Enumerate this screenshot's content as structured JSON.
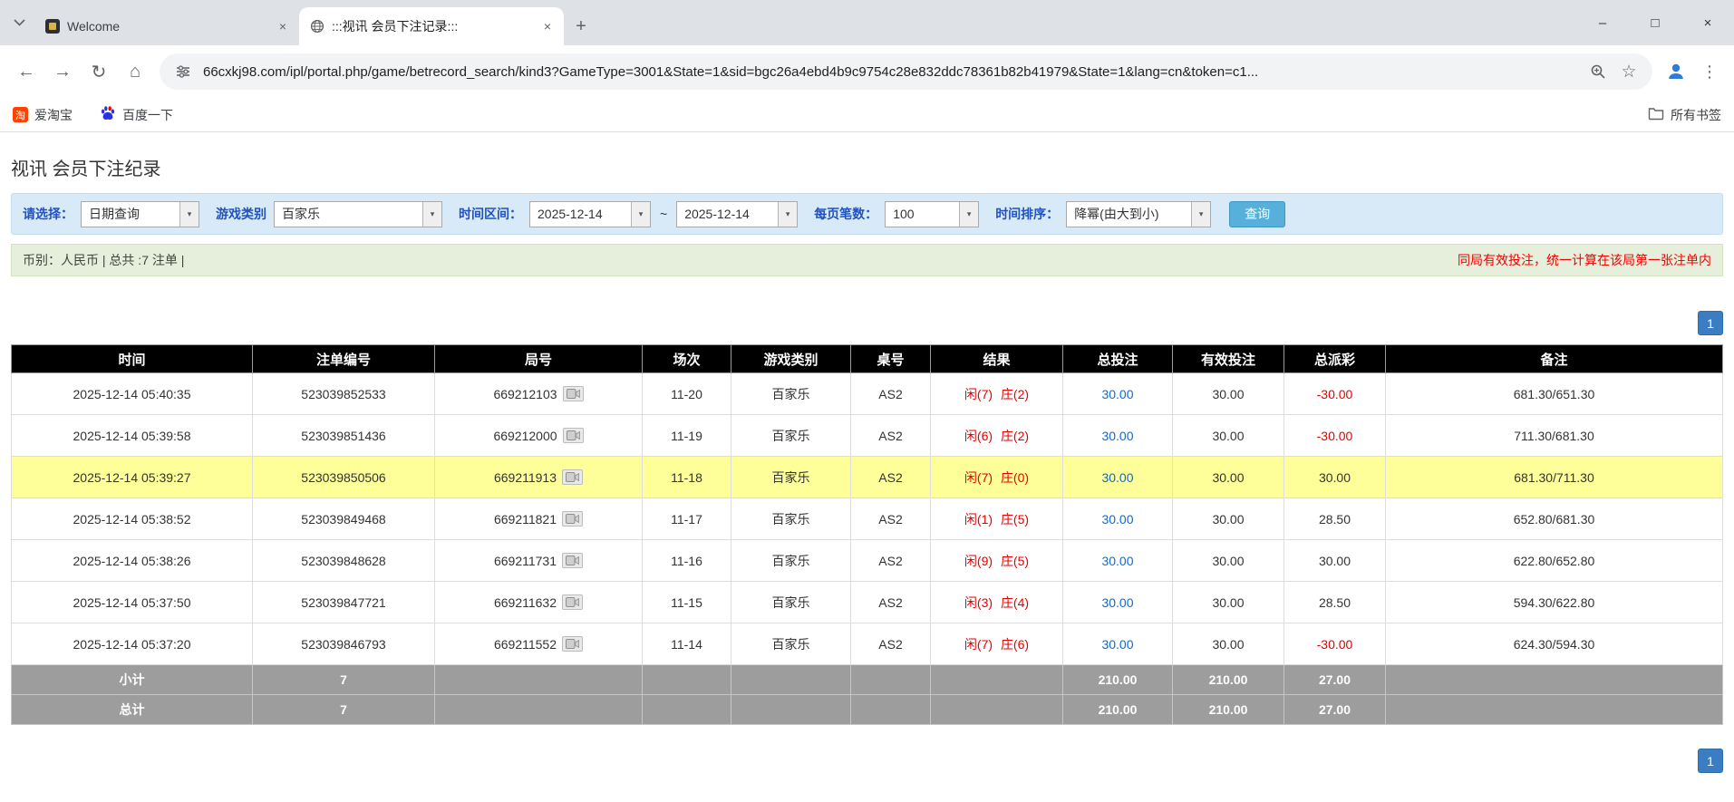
{
  "colors": {
    "accent_blue": "#2052c0",
    "link_blue": "#0a6cd6",
    "negative_red": "#e60000",
    "result_red": "#e60000",
    "highlight_yellow": "#ffff99",
    "table_header_bg": "#000000",
    "summary_bg": "#9d9d9d",
    "search_button_bg": "#57b0da",
    "pager_bg": "#3b7dc2",
    "filter_bar_bg": "#d8eaf7",
    "info_bar_bg": "#e5efdb"
  },
  "icons": {
    "back": "←",
    "forward": "→",
    "reload": "↻",
    "home": "⌂",
    "star": "☆",
    "menu": "⋮",
    "minimize": "–",
    "maximize": "□",
    "close": "×",
    "new_tab": "+",
    "tab_close": "×",
    "combo_arrow": "▾"
  },
  "browser": {
    "tabs": [
      {
        "title": "Welcome"
      },
      {
        "title": ":::视讯 会员下注记录:::"
      }
    ],
    "url": "66cxkj98.com/ipl/portal.php/game/betrecord_search/kind3?GameType=3001&State=1&sid=bgc26a4ebd4b9c9754c28e832ddc78361b82b41979&State=1&lang=cn&token=c1...",
    "bookmarks": [
      {
        "label": "爱淘宝"
      },
      {
        "label": "百度一下"
      }
    ],
    "all_bookmarks": "所有书签"
  },
  "page": {
    "title": "视讯 会员下注纪录",
    "filters": {
      "select_label": "请选择：",
      "select_value": "日期查询",
      "game_label": "游戏类别",
      "game_value": "百家乐",
      "range_label": "时间区间：",
      "date_from": "2025-12-14",
      "date_to": "2025-12-14",
      "range_sep": "~",
      "page_size_label": "每页笔数：",
      "page_size_value": "100",
      "sort_label": "时间排序：",
      "sort_value": "降幂(由大到小)",
      "search_button": "查询"
    },
    "info_left": "币别：人民币 | 总共 :7 注单 |",
    "info_right": "同局有效投注，统一计算在该局第一张注单内",
    "pagination": "1",
    "table": {
      "headers": [
        "时间",
        "注单编号",
        "局号",
        "场次",
        "游戏类别",
        "桌号",
        "结果",
        "总投注",
        "有效投注",
        "总派彩",
        "备注"
      ],
      "rows": [
        {
          "time": "2025-12-14 05:40:35",
          "bet_id": "523039852533",
          "round": "669212103",
          "session": "11-20",
          "game": "百家乐",
          "table_no": "AS2",
          "result_player": "闲(7)",
          "result_banker": "庄(2)",
          "total_bet": "30.00",
          "valid_bet": "30.00",
          "payout": "-30.00",
          "note": "681.30/651.30",
          "highlighted": false
        },
        {
          "time": "2025-12-14 05:39:58",
          "bet_id": "523039851436",
          "round": "669212000",
          "session": "11-19",
          "game": "百家乐",
          "table_no": "AS2",
          "result_player": "闲(6)",
          "result_banker": "庄(2)",
          "total_bet": "30.00",
          "valid_bet": "30.00",
          "payout": "-30.00",
          "note": "711.30/681.30",
          "highlighted": false
        },
        {
          "time": "2025-12-14 05:39:27",
          "bet_id": "523039850506",
          "round": "669211913",
          "session": "11-18",
          "game": "百家乐",
          "table_no": "AS2",
          "result_player": "闲(7)",
          "result_banker": "庄(0)",
          "total_bet": "30.00",
          "valid_bet": "30.00",
          "payout": "30.00",
          "note": "681.30/711.30",
          "highlighted": true
        },
        {
          "time": "2025-12-14 05:38:52",
          "bet_id": "523039849468",
          "round": "669211821",
          "session": "11-17",
          "game": "百家乐",
          "table_no": "AS2",
          "result_player": "闲(1)",
          "result_banker": "庄(5)",
          "total_bet": "30.00",
          "valid_bet": "30.00",
          "payout": "28.50",
          "note": "652.80/681.30",
          "highlighted": false
        },
        {
          "time": "2025-12-14 05:38:26",
          "bet_id": "523039848628",
          "round": "669211731",
          "session": "11-16",
          "game": "百家乐",
          "table_no": "AS2",
          "result_player": "闲(9)",
          "result_banker": "庄(5)",
          "total_bet": "30.00",
          "valid_bet": "30.00",
          "payout": "30.00",
          "note": "622.80/652.80",
          "highlighted": false
        },
        {
          "time": "2025-12-14 05:37:50",
          "bet_id": "523039847721",
          "round": "669211632",
          "session": "11-15",
          "game": "百家乐",
          "table_no": "AS2",
          "result_player": "闲(3)",
          "result_banker": "庄(4)",
          "total_bet": "30.00",
          "valid_bet": "30.00",
          "payout": "28.50",
          "note": "594.30/622.80",
          "highlighted": false
        },
        {
          "time": "2025-12-14 05:37:20",
          "bet_id": "523039846793",
          "round": "669211552",
          "session": "11-14",
          "game": "百家乐",
          "table_no": "AS2",
          "result_player": "闲(7)",
          "result_banker": "庄(6)",
          "total_bet": "30.00",
          "valid_bet": "30.00",
          "payout": "-30.00",
          "note": "624.30/594.30",
          "highlighted": false
        }
      ],
      "summary_rows": [
        {
          "label": "小计",
          "count": "7",
          "total_bet": "210.00",
          "valid_bet": "210.00",
          "payout": "27.00"
        },
        {
          "label": "总计",
          "count": "7",
          "total_bet": "210.00",
          "valid_bet": "210.00",
          "payout": "27.00"
        }
      ]
    }
  }
}
